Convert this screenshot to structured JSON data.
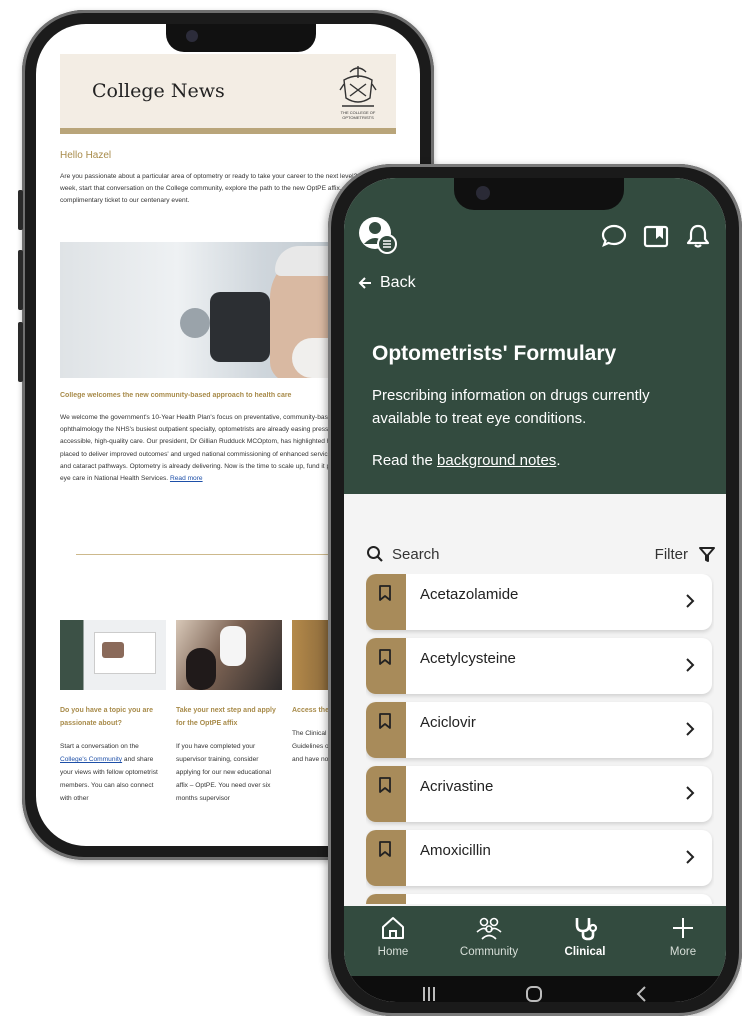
{
  "back_phone": {
    "header_title": "College News",
    "crest_caption": "THE COLLEGE OF OPTOMETRISTS",
    "greeting": "Hello Hazel",
    "intro": "Are you passionate about a particular area of optometry or ready to take your career to the next level? This week, start that conversation on the College community, explore the path to the new OptPE affix. Also, book your complimentary ticket to our centenary event.",
    "headline": "College welcomes the new community-based approach to health care",
    "article": "We welcome the government's 10-Year Health Plan's focus on preventative, community-based care. With ophthalmology the NHS's busiest outpatient specialty, optometrists are already easing pressure by providing accessible, high-quality care. Our president, Dr Gillian Rudduck MCOptom, has highlighted how optometrists are placed to deliver improved outcomes' and urged national commissioning of enhanced services like urgent eye care and cataract pathways. Optometry is already delivering. Now is the time to scale up, fund it properly, and embed eye care in National Health Services.",
    "read_more": "Read more",
    "cards": [
      {
        "title": "Do you have a topic you are passionate about?",
        "body_pre": "Start a conversation on the ",
        "link": "College's Community",
        "body_post": " and share your views with fellow optometrist members. You can also connect with other"
      },
      {
        "title": "Take your next step and apply for the OptPE affix",
        "body_pre": "If you have completed your supervisor training, consider applying for our new educational affix – OptPE. You need over six months supervisor",
        "link": "",
        "body_post": ""
      },
      {
        "title": "Access the CMGs on the app",
        "body_pre": "The Clinical Management Guidelines on phthiriasis, traction, and have now",
        "link": "",
        "body_post": ""
      }
    ]
  },
  "front_phone": {
    "back_label": "Back",
    "title": "Optometrists' Formulary",
    "subtitle": "Prescribing information on drugs currently available to treat eye conditions.",
    "notes_pre": "Read the ",
    "notes_link": "background notes",
    "notes_post": ".",
    "search_label": "Search",
    "filter_label": "Filter",
    "drugs": [
      "Acetazolamide",
      "Acetylcysteine",
      "Aciclovir",
      "Acrivastine",
      "Amoxicillin",
      ""
    ],
    "tabs": [
      {
        "label": "Home",
        "icon": "home-icon"
      },
      {
        "label": "Community",
        "icon": "community-icon"
      },
      {
        "label": "Clinical",
        "icon": "stethoscope-icon"
      },
      {
        "label": "More",
        "icon": "plus-icon"
      }
    ],
    "active_tab": "Clinical",
    "colors": {
      "brand_green": "#334b3f",
      "accent_gold": "#a88b5a",
      "link_gold": "#a88b4a"
    }
  }
}
